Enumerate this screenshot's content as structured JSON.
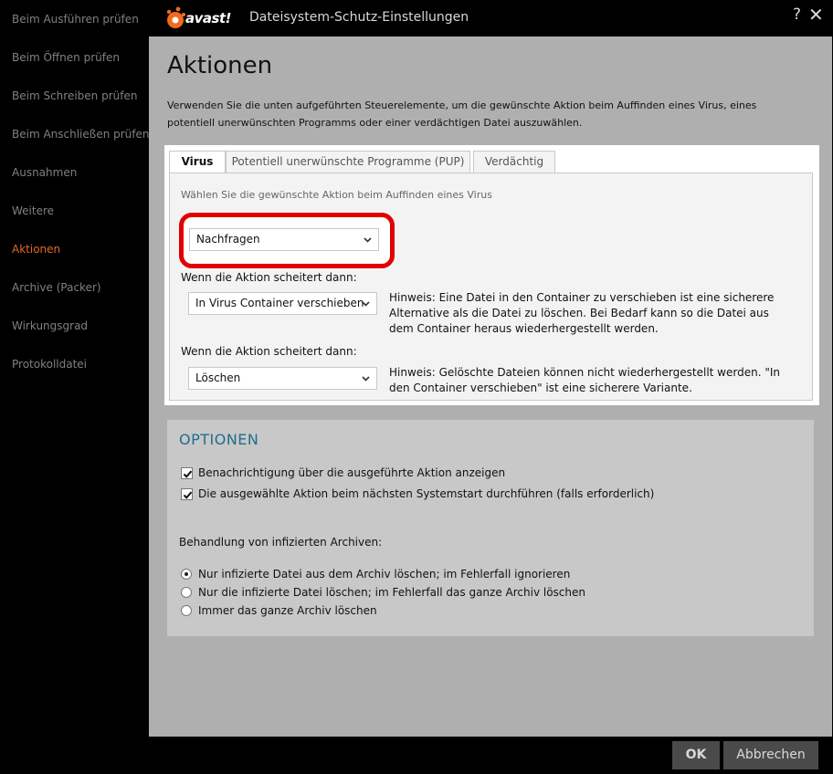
{
  "app": {
    "brand": "avast!",
    "window_title": "Dateisystem-Schutz-Einstellungen",
    "help": "?",
    "close": "✕"
  },
  "sidebar": {
    "items": [
      {
        "label": "Beim Ausführen prüfen"
      },
      {
        "label": "Beim Öffnen prüfen"
      },
      {
        "label": "Beim Schreiben prüfen"
      },
      {
        "label": "Beim Anschließen prüfen"
      },
      {
        "label": "Ausnahmen"
      },
      {
        "label": "Weitere"
      },
      {
        "label": "Aktionen",
        "active": true
      },
      {
        "label": "Archive (Packer)"
      },
      {
        "label": "Wirkungsgrad"
      },
      {
        "label": "Protokolldatei"
      }
    ]
  },
  "main": {
    "title": "Aktionen",
    "intro": "Verwenden Sie die unten aufgeführten Steuerelemente, um die gewünschte Aktion beim Auffinden eines Virus, eines potentiell unerwünschten Programms oder einer verdächtigen Datei auszuwählen.",
    "tabs": [
      {
        "label": "Virus",
        "active": true
      },
      {
        "label": "Potentiell unerwünschte Programme (PUP)"
      },
      {
        "label": "Verdächtig"
      }
    ],
    "tab_hint": "Wählen Sie die gewünschte Aktion beim Auffinden eines Virus",
    "primary_action": "Nachfragen",
    "fallback1": {
      "label": "Wenn die Aktion scheitert dann:",
      "value": "In Virus Container verschieben",
      "note": "Hinweis: Eine Datei in den Container zu verschieben ist eine sicherere Alternative als die Datei zu löschen. Bei Bedarf kann so die Datei aus dem Container heraus wiederhergestellt werden."
    },
    "fallback2": {
      "label": "Wenn die Aktion scheitert dann:",
      "value": "Löschen",
      "note": "Hinweis: Gelöschte Dateien können nicht wiederhergestellt werden. \"In den Container verschieben\" ist eine sicherere Variante."
    }
  },
  "options": {
    "title": "OPTIONEN",
    "checkboxes": [
      {
        "label": "Benachrichtigung über die ausgeführte Aktion anzeigen",
        "checked": true
      },
      {
        "label": "Die ausgewählte Aktion beim nächsten Systemstart durchführen (falls erforderlich)",
        "checked": true
      }
    ],
    "archive_label": "Behandlung von infizierten Archiven:",
    "radios": [
      {
        "label": "Nur infizierte Datei aus dem Archiv löschen; im Fehlerfall ignorieren",
        "selected": true
      },
      {
        "label": "Nur die infizierte Datei löschen; im Fehlerfall das ganze Archiv löschen",
        "selected": false
      },
      {
        "label": "Immer das ganze Archiv löschen",
        "selected": false
      }
    ]
  },
  "footer": {
    "ok": "OK",
    "cancel": "Abbrechen"
  },
  "colors": {
    "accent": "#e06a25",
    "highlight": "#e30000",
    "options_title": "#1f6e8c",
    "content_bg": "#afafaf"
  }
}
